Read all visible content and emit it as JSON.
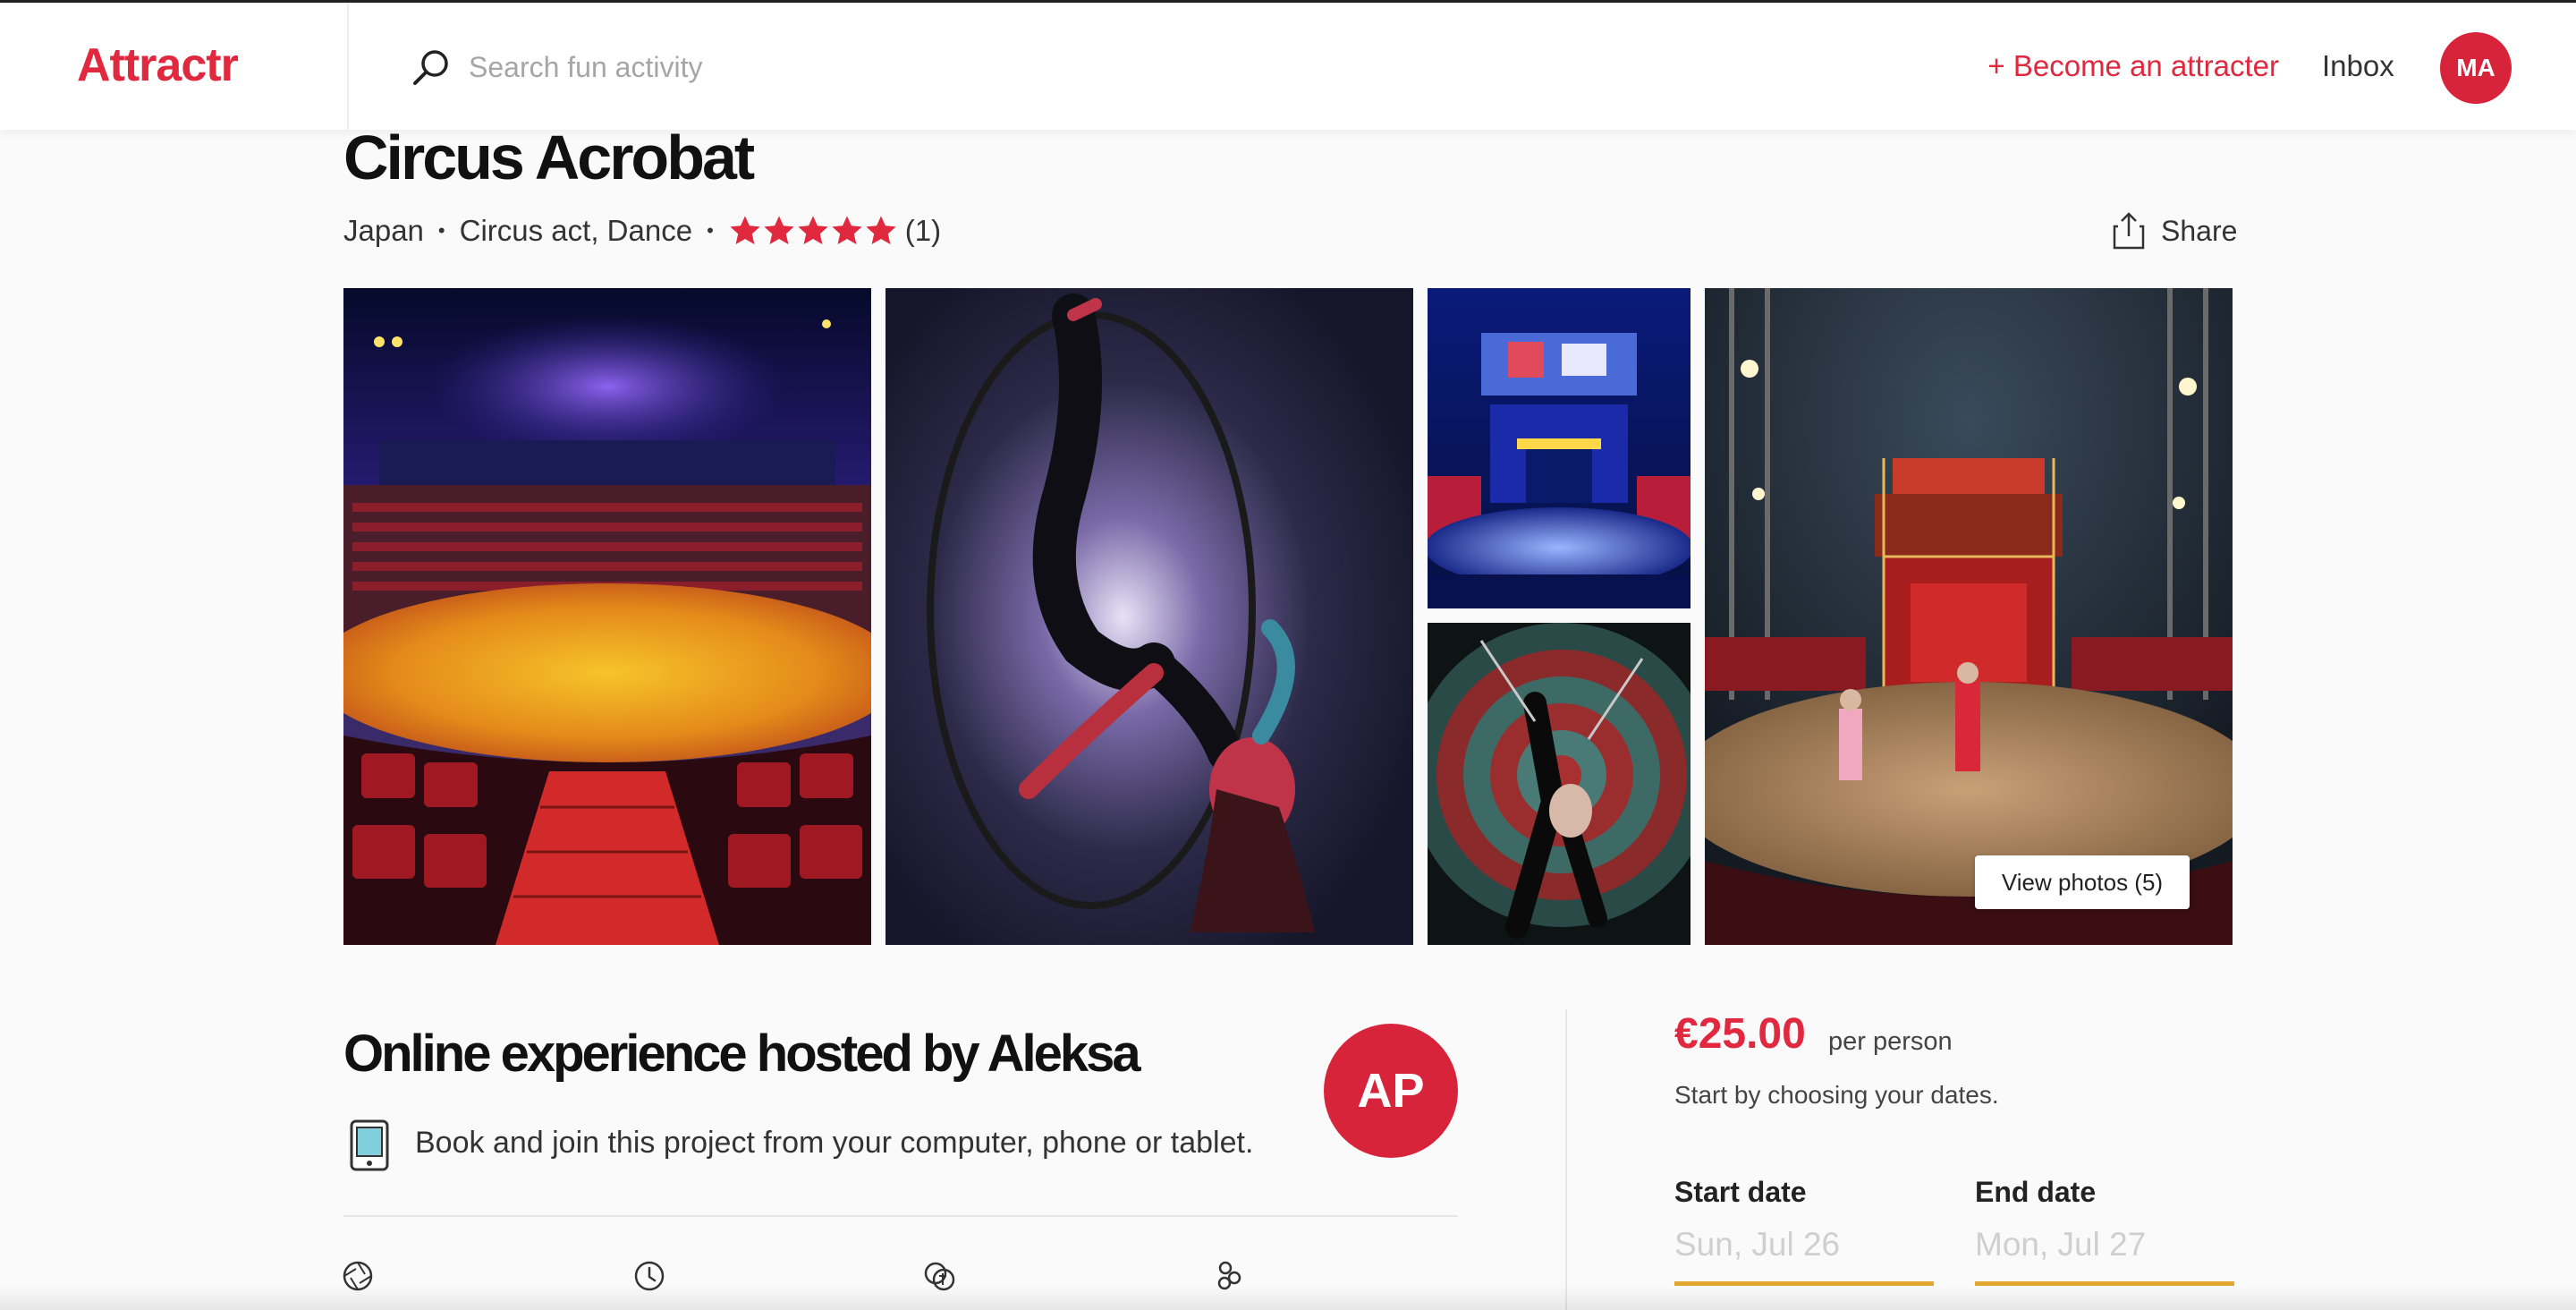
{
  "header": {
    "logo": "Attractr",
    "search_placeholder": "Search fun activity",
    "become_label": "+ Become an attracter",
    "inbox_label": "Inbox",
    "user_initials": "MA"
  },
  "experience": {
    "title": "Circus Acrobat",
    "location": "Japan",
    "categories": "Circus act, Dance",
    "rating_stars": 5,
    "review_count": "(1)",
    "share_label": "Share"
  },
  "gallery": {
    "view_photos_label": "View photos (5)"
  },
  "host": {
    "title": "Online experience hosted by Aleksa",
    "initials": "AP",
    "description": "Book and join this project from your computer, phone or tablet."
  },
  "booking": {
    "price": "€25.00",
    "price_unit": "per person",
    "hint": "Start by choosing your dates.",
    "start_label": "Start date",
    "start_value": "Sun, Jul 26",
    "end_label": "End date",
    "end_value": "Mon, Jul 27"
  },
  "colors": {
    "brand": "#e0283f",
    "date_underline": "#e3a72f"
  }
}
